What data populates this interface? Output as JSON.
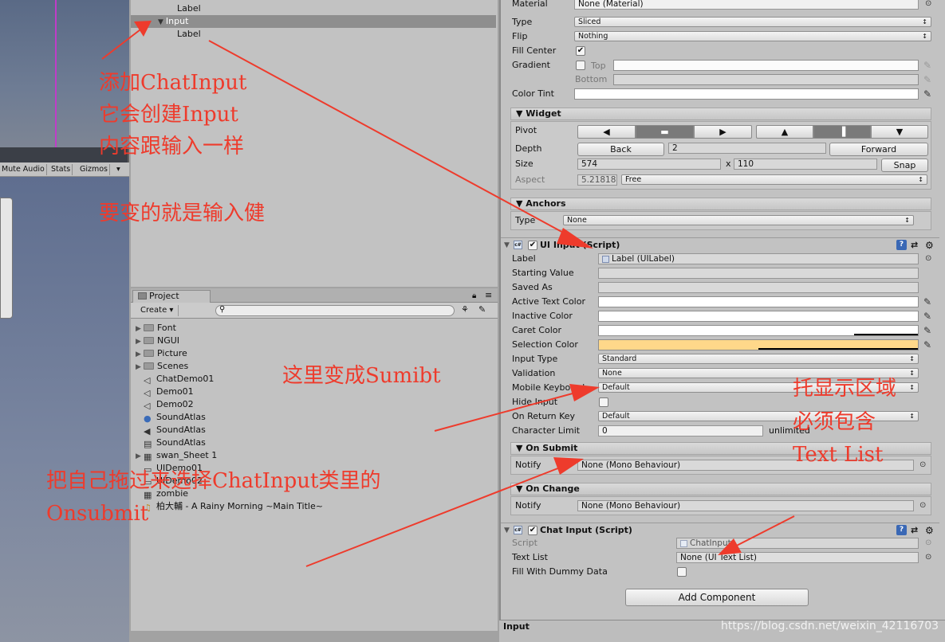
{
  "scene": {
    "toolbar_items": [
      "Mute Audio",
      "Stats",
      "Gizmos"
    ]
  },
  "hierarchy": {
    "rows": [
      {
        "label": "Label",
        "selected": false
      },
      {
        "label": "Input",
        "selected": true
      },
      {
        "label": "Label",
        "selected": false
      }
    ]
  },
  "project": {
    "tab_label": "Project",
    "create_label": "Create",
    "items": [
      {
        "label": "Font",
        "icon": "folder-icon"
      },
      {
        "label": "NGUI",
        "icon": "folder-icon"
      },
      {
        "label": "Picture",
        "icon": "folder-icon"
      },
      {
        "label": "Scenes",
        "icon": "folder-icon"
      },
      {
        "label": "ChatDemo01",
        "icon": "unity-scene-icon"
      },
      {
        "label": "Demo01",
        "icon": "unity-scene-icon"
      },
      {
        "label": "Demo02",
        "icon": "unity-scene-icon"
      },
      {
        "label": "SoundAtlas",
        "icon": "material-sphere-icon"
      },
      {
        "label": "SoundAtlas",
        "icon": "audio-icon"
      },
      {
        "label": "SoundAtlas",
        "icon": "prefab-icon"
      },
      {
        "label": "swan_Sheet 1",
        "icon": "texture-icon"
      },
      {
        "label": "UIDemo01",
        "icon": "scene-icon"
      },
      {
        "label": "UIDemo02",
        "icon": "scene-icon"
      },
      {
        "label": "zombie",
        "icon": "texture-icon"
      },
      {
        "label": "柏大輔 - A Rainy Morning ~Main Title~",
        "icon": "audio-clip-icon"
      }
    ]
  },
  "inspector": {
    "material": {
      "label": "Material",
      "value": "None (Material)"
    },
    "type": {
      "label": "Type",
      "value": "Sliced"
    },
    "flip": {
      "label": "Flip",
      "value": "Nothing"
    },
    "fill_center": {
      "label": "Fill Center",
      "checked": true
    },
    "gradient": {
      "label": "Gradient",
      "top": "Top",
      "bottom": "Bottom"
    },
    "color_tint": {
      "label": "Color Tint"
    },
    "widget": {
      "title": "Widget",
      "pivot_label": "Pivot",
      "depth_label": "Depth",
      "back_label": "Back",
      "depth_value": "2",
      "forward_label": "Forward",
      "size_label": "Size",
      "size_w": "574",
      "x_sep": "x",
      "size_h": "110",
      "snap_label": "Snap",
      "aspect_label": "Aspect",
      "aspect_value": "5.21818",
      "aspect_mode": "Free"
    },
    "anchors": {
      "title": "Anchors",
      "type_label": "Type",
      "type_value": "None"
    },
    "ui_input": {
      "title": "UI Input (Script)",
      "label": {
        "label": "Label",
        "value": "Label (UILabel)"
      },
      "starting_value": "Starting Value",
      "saved_as": "Saved As",
      "active_text_color": "Active Text Color",
      "inactive_color": "Inactive Color",
      "caret_color": "Caret Color",
      "selection_color": "Selection Color",
      "input_type": {
        "label": "Input Type",
        "value": "Standard"
      },
      "validation": {
        "label": "Validation",
        "value": "None"
      },
      "mobile_keyboard": {
        "label": "Mobile Keyboard",
        "value": "Default"
      },
      "hide_input": "Hide Input",
      "on_return_key": {
        "label": "On Return Key",
        "value": "Default"
      },
      "character_limit": {
        "label": "Character Limit",
        "value": "0",
        "suffix": "unlimited"
      },
      "on_submit": {
        "title": "On Submit",
        "notify": "Notify",
        "value": "None (Mono Behaviour)"
      },
      "on_change": {
        "title": "On Change",
        "notify": "Notify",
        "value": "None (Mono Behaviour)"
      },
      "selection_color_hex": "#ffd88a"
    },
    "chat_input": {
      "title": "Chat Input (Script)",
      "script_label": "Script",
      "script_value": "ChatInput",
      "text_list_label": "Text List",
      "text_list_value": "None (UI Text List)",
      "fill_dummy_label": "Fill With Dummy Data"
    },
    "add_component": "Add Component",
    "status": "Input"
  },
  "annotations": {
    "a1_line1": "添加ChatInput",
    "a1_line2": "它会创建Input",
    "a1_line3": "内容跟输入一样",
    "a2": "要变的就是输入健",
    "a3": "这里变成Sumibt",
    "a4_line1": "托显示区域",
    "a4_line2": "必须包含",
    "a4_line3": "Text List",
    "a5_line1": "把自己拖过来选择ChatInput类里的",
    "a5_line2": "Onsubmit",
    "arrow_color": "#ee3b2c"
  },
  "watermark": "https://blog.csdn.net/weixin_42116703"
}
